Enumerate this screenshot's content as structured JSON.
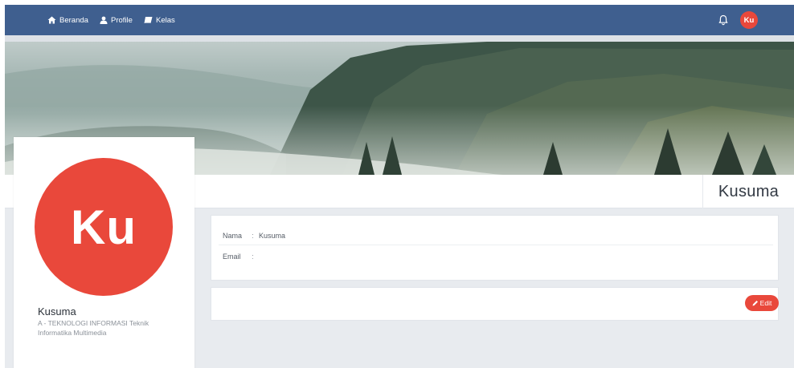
{
  "navbar": {
    "items": [
      {
        "label": "Beranda",
        "icon": "home-icon"
      },
      {
        "label": "Profile",
        "icon": "user-icon"
      },
      {
        "label": "Kelas",
        "icon": "book-icon"
      }
    ],
    "notification_icon": "bell-icon",
    "avatar_initials": "Ku",
    "background_color": "#3f5f8f"
  },
  "profile": {
    "display_name": "Kusuma",
    "avatar_initials": "Ku",
    "card_name": "Kusuma",
    "card_subtitle": "A - TEKNOLOGI INFORMASI Teknik Informatika Multimedia",
    "avatar_color": "#e9483b"
  },
  "info": {
    "rows": [
      {
        "label": "Nama",
        "separator": ":",
        "value": "Kusuma"
      },
      {
        "label": "Email",
        "separator": ":",
        "value": ""
      }
    ]
  },
  "actions": {
    "edit_label": "Edit",
    "edit_icon": "pencil-icon",
    "button_color": "#e9483b"
  }
}
